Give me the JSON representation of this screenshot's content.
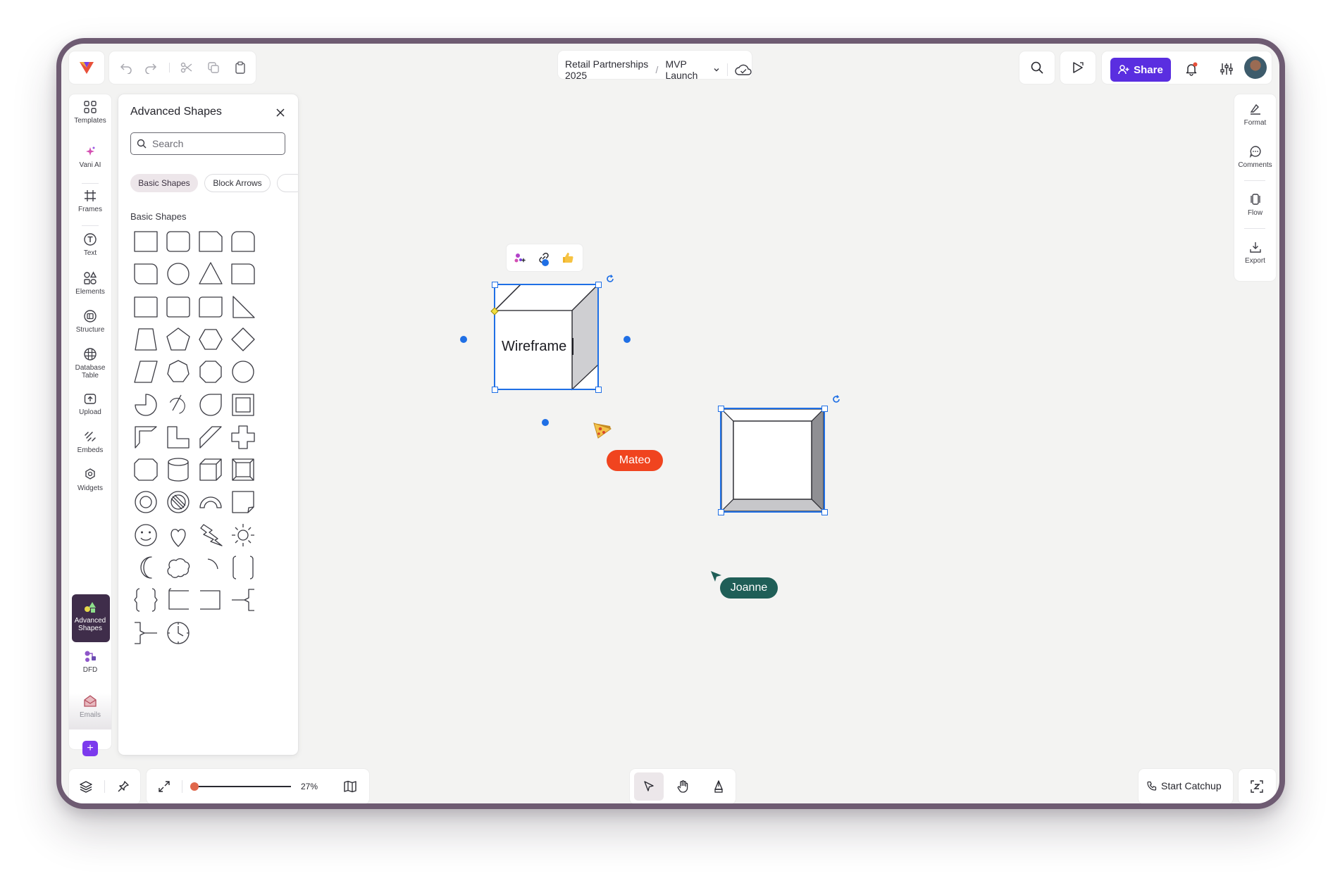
{
  "topbar": {
    "breadcrumb_project": "Retail Partnerships 2025",
    "breadcrumb_separator": "/",
    "breadcrumb_board": "MVP Launch",
    "share_label": "Share"
  },
  "sidebar": {
    "items": [
      {
        "label": "Templates",
        "icon": "templates-icon"
      },
      {
        "label": "Vani AI",
        "icon": "vani-ai-icon"
      },
      {
        "label": "Frames",
        "icon": "frames-icon"
      },
      {
        "label": "Text",
        "icon": "text-icon"
      },
      {
        "label": "Elements",
        "icon": "elements-icon"
      },
      {
        "label": "Structure",
        "icon": "structure-icon"
      },
      {
        "label": "Database Table",
        "icon": "database-table-icon"
      },
      {
        "label": "Upload",
        "icon": "upload-icon"
      },
      {
        "label": "Embeds",
        "icon": "embeds-icon"
      },
      {
        "label": "Widgets",
        "icon": "widgets-icon"
      },
      {
        "label": "Advanced Shapes",
        "icon": "advanced-shapes-icon",
        "active": true
      },
      {
        "label": "DFD",
        "icon": "dfd-icon"
      },
      {
        "label": "Emails",
        "icon": "emails-icon"
      }
    ],
    "add_label": "+"
  },
  "panel": {
    "title": "Advanced Shapes",
    "search_placeholder": "Search",
    "categories": [
      "Basic Shapes",
      "Block Arrows"
    ],
    "section_label": "Basic Shapes"
  },
  "right_rail": {
    "items": [
      {
        "label": "Format",
        "icon": "format-icon"
      },
      {
        "label": "Comments",
        "icon": "comments-icon"
      },
      {
        "label": "Flow",
        "icon": "flow-icon"
      },
      {
        "label": "Export",
        "icon": "export-icon"
      }
    ]
  },
  "canvas": {
    "selected_shape_text": "Wireframe",
    "collaborators": [
      {
        "name": "Mateo",
        "color": "#f0441f"
      },
      {
        "name": "Joanne",
        "color": "#1f5e57"
      }
    ]
  },
  "bottombar": {
    "zoom_level": "27%",
    "zoom_fraction": 0.0,
    "start_catchup_label": "Start Catchup"
  },
  "colors": {
    "accent": "#5a2ee0",
    "selection": "#1f6fe5",
    "device_frame": "#6e5b72",
    "active_rail": "#3f2d4a"
  }
}
